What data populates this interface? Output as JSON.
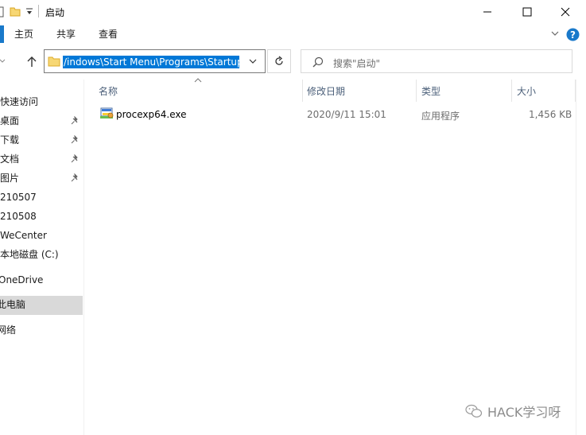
{
  "window": {
    "title": "启动"
  },
  "ribbon": {
    "tabs": [
      {
        "label": "主页"
      },
      {
        "label": "共享"
      },
      {
        "label": "查看"
      }
    ]
  },
  "address": {
    "path": "/indows\\Start Menu\\Programs\\Startup"
  },
  "search": {
    "placeholder": "搜索\"启动\""
  },
  "nav": {
    "items": [
      {
        "label": "快速访问"
      },
      {
        "label": "桌面"
      },
      {
        "label": "下载"
      },
      {
        "label": "文档"
      },
      {
        "label": "图片"
      },
      {
        "label": "210507"
      },
      {
        "label": "210508"
      },
      {
        "label": "WeCenter"
      },
      {
        "label": "本地磁盘 (C:)"
      },
      {
        "label": "OneDrive"
      },
      {
        "label": "此电脑"
      },
      {
        "label": "网络"
      }
    ]
  },
  "columns": {
    "name": "名称",
    "date": "修改日期",
    "type": "类型",
    "size": "大小"
  },
  "files": [
    {
      "name": "procexp64.exe",
      "date": "2020/9/11 15:01",
      "type": "应用程序",
      "size": "1,456 KB"
    }
  ],
  "watermark": {
    "text": "HACK学习呀"
  }
}
